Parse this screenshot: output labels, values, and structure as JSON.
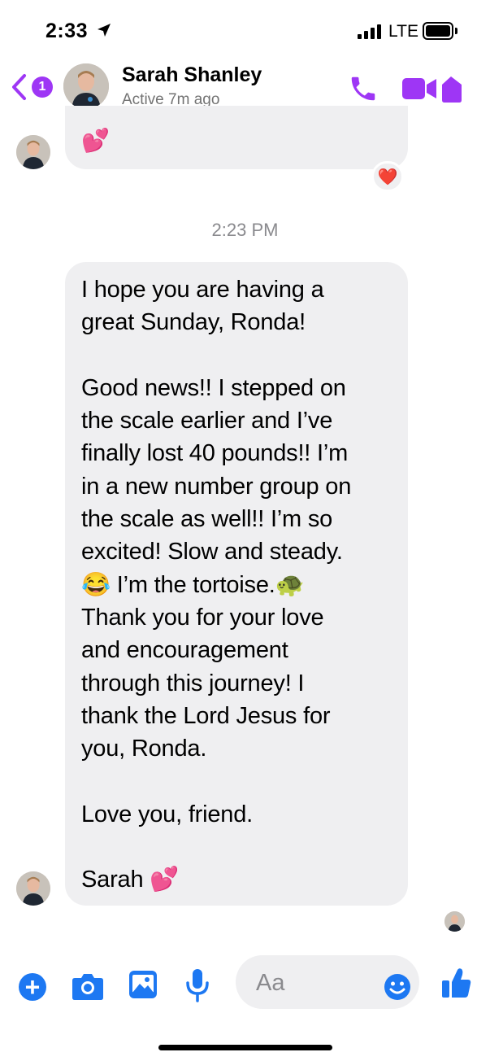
{
  "status_bar": {
    "time": "2:33",
    "carrier": "LTE"
  },
  "header": {
    "badge_count": "1",
    "contact_name": "Sarah Shanley",
    "contact_status": "Active 7m ago"
  },
  "messages": {
    "previous_emoji": "💕",
    "previous_reaction": "❤️",
    "timestamp": "2:23 PM",
    "main_text": "I hope you are having a\ngreat Sunday, Ronda!\n\nGood news!! I stepped on\nthe scale earlier and I’ve\nfinally lost 40 pounds!! I’m\nin a new number group on\nthe scale as well!! I’m so\nexcited! Slow and steady.\n😂 I’m the tortoise.🐢\nThank you for your love\nand encouragement\nthrough this journey! I\nthank the Lord Jesus for\nyou, Ronda.\n\nLove you, friend.\n\nSarah 💕"
  },
  "composer": {
    "placeholder": "Aa"
  },
  "colors": {
    "accent_purple": "#9e36f5",
    "accent_blue": "#1d78f2",
    "bubble_gray": "#efeff1"
  },
  "icons": [
    "location-arrow-icon",
    "signal-icon",
    "battery-icon",
    "back-chevron-icon",
    "phone-icon",
    "video-camera-icon",
    "plus-icon",
    "camera-icon",
    "photo-icon",
    "microphone-icon",
    "emoji-icon",
    "thumbs-up-icon"
  ]
}
